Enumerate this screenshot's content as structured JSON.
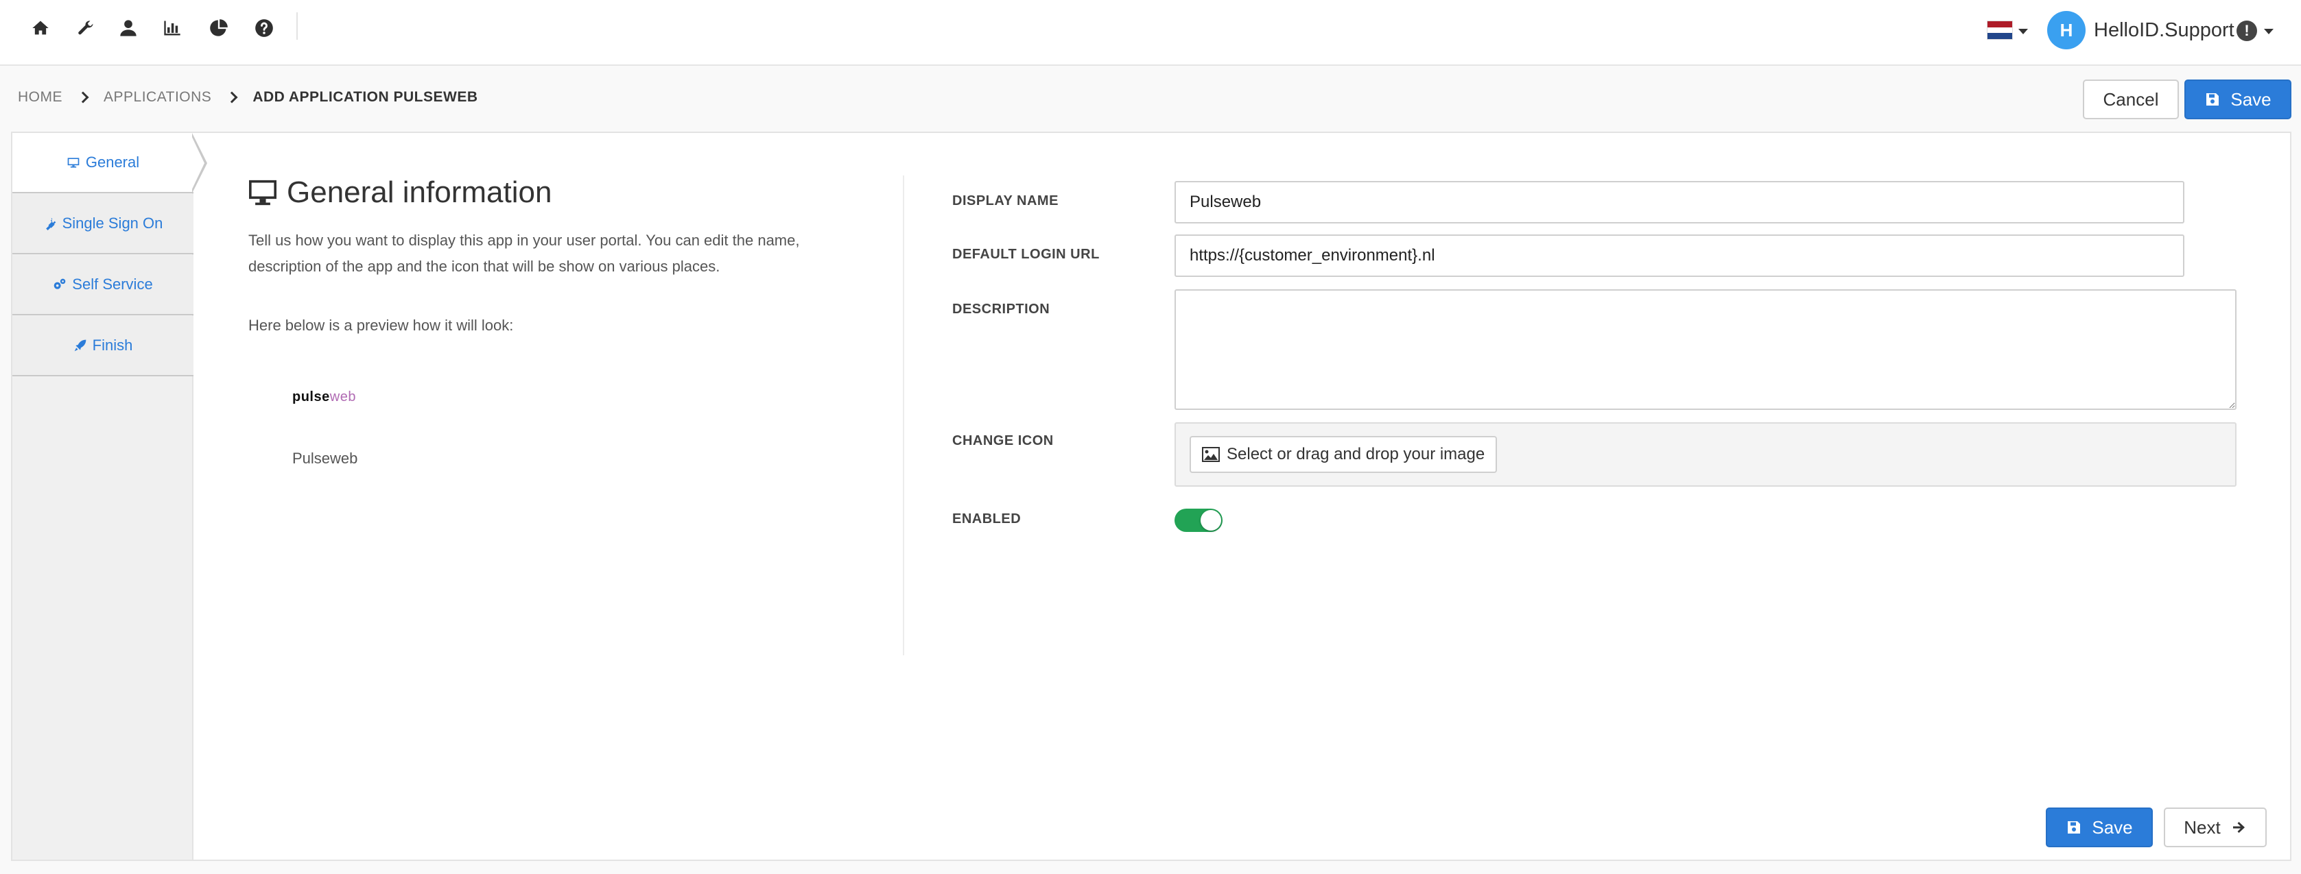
{
  "nav": {
    "icons": [
      "home-icon",
      "wrench-icon",
      "user-icon",
      "bar-chart-icon",
      "pie-chart-icon",
      "help-icon"
    ]
  },
  "header": {
    "language_flag": "netherlands-flag",
    "avatar_initial": "H",
    "username": "HelloID.Support",
    "alert_glyph": "!"
  },
  "breadcrumb": {
    "items": [
      "HOME",
      "APPLICATIONS",
      "ADD APPLICATION PULSEWEB"
    ]
  },
  "actions": {
    "cancel_label": "Cancel",
    "save_label": "Save",
    "next_label": "Next"
  },
  "sidebar": {
    "tabs": [
      {
        "label": "General",
        "icon": "monitor-icon",
        "active": true
      },
      {
        "label": "Single Sign On",
        "icon": "plug-icon",
        "active": false
      },
      {
        "label": "Self Service",
        "icon": "gears-icon",
        "active": false
      },
      {
        "label": "Finish",
        "icon": "rocket-icon",
        "active": false
      }
    ]
  },
  "general": {
    "title": "General information",
    "description": "Tell us how you want to display this app in your user portal. You can edit the name, description of the app and the icon that will be show on various places.",
    "preview_text": "Here below is a preview how it will look:",
    "preview_logo_part1": "pulse",
    "preview_logo_part2": "web",
    "preview_name": "Pulseweb"
  },
  "form": {
    "display_name_label": "DISPLAY NAME",
    "display_name_value": "Pulseweb",
    "login_url_label": "DEFAULT LOGIN URL",
    "login_url_value": "https://{customer_environment}.nl",
    "description_label": "DESCRIPTION",
    "description_value": "",
    "change_icon_label": "CHANGE ICON",
    "change_icon_button": "Select or drag and drop your image",
    "enabled_label": "ENABLED",
    "enabled": true
  },
  "colors": {
    "primary": "#2b7cd9",
    "toggle_on": "#22a355",
    "avatar": "#3aa0f0"
  }
}
